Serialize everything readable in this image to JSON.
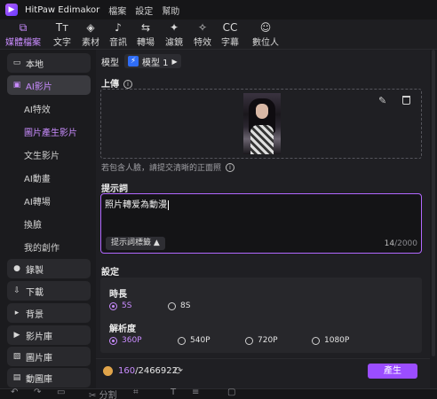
{
  "app": {
    "title": "HitPaw Edimakor",
    "logo_glyph": "▶",
    "menu": [
      "檔案",
      "設定",
      "幫助"
    ]
  },
  "toolbar": {
    "tools": [
      {
        "label": "媒體檔案",
        "icon": "media-files-icon",
        "glyph": "⧉",
        "active": true
      },
      {
        "label": "文字",
        "icon": "text-icon",
        "glyph": "Tт",
        "active": false
      },
      {
        "label": "素材",
        "icon": "assets-icon",
        "glyph": "◈",
        "active": false
      },
      {
        "label": "音訊",
        "icon": "audio-icon",
        "glyph": "♪",
        "active": false
      },
      {
        "label": "轉場",
        "icon": "transition-icon",
        "glyph": "⇆",
        "active": false
      },
      {
        "label": "濾鏡",
        "icon": "filter-icon",
        "glyph": "✦",
        "active": false
      },
      {
        "label": "特效",
        "icon": "effects-icon",
        "glyph": "✧",
        "active": false
      },
      {
        "label": "字幕",
        "icon": "subtitle-icon",
        "glyph": "CC",
        "active": false
      },
      {
        "label": "數位人",
        "icon": "digital-human-icon",
        "glyph": "☺",
        "active": false
      }
    ]
  },
  "sidebar": {
    "items": [
      {
        "label": "本地",
        "icon": "folder-icon",
        "glyph": "▭",
        "active": false
      },
      {
        "label": "AI影片",
        "icon": "ai-video-icon",
        "glyph": "▣",
        "active": true
      },
      {
        "label": "錄製",
        "icon": "record-icon",
        "glyph": "●",
        "active": false
      },
      {
        "label": "下載",
        "icon": "download-icon",
        "glyph": "⇩",
        "active": false
      },
      {
        "label": "背景",
        "icon": "background-icon",
        "glyph": "▸",
        "active": false
      },
      {
        "label": "影片庫",
        "icon": "video-library-icon",
        "glyph": "▶",
        "active": false
      },
      {
        "label": "圖片庫",
        "icon": "image-library-icon",
        "glyph": "▨",
        "active": false
      },
      {
        "label": "動圖庫",
        "icon": "gif-library-icon",
        "glyph": "▤",
        "active": false
      }
    ],
    "sub_items": [
      {
        "label": "AI特效",
        "active": false
      },
      {
        "label": "圖片產生影片",
        "active": true
      },
      {
        "label": "文生影片",
        "active": false
      },
      {
        "label": "AI動畫",
        "active": false
      },
      {
        "label": "AI轉場",
        "active": false
      },
      {
        "label": "換臉",
        "active": false
      },
      {
        "label": "我的創作",
        "active": false
      }
    ]
  },
  "main": {
    "model": {
      "label": "模型",
      "value": "模型 1",
      "bolt": "⚡",
      "caret": "▶"
    },
    "upload": {
      "title": "上傳",
      "info": "i",
      "hint": "若包含人臉，請提交清晰的正面照"
    },
    "prompt": {
      "title": "提示詞",
      "value": "照片轉爱為動漫",
      "tag_label": "提示詞標籤 ▲",
      "count": "14",
      "max": "/2000"
    },
    "settings": {
      "title": "設定",
      "duration": {
        "label": "時長",
        "options": [
          "5S",
          "8S"
        ],
        "selected": "5S"
      },
      "resolution": {
        "label": "解析度",
        "options": [
          "360P",
          "540P",
          "720P",
          "1080P"
        ],
        "selected": "360P"
      }
    }
  },
  "footer": {
    "credits_used": "160",
    "credits_total": "/2466922",
    "generate_label": "產生"
  },
  "editbar": {
    "split_label": "分割"
  },
  "colors": {
    "accent": "#c98cff",
    "button": "#9b4dff",
    "background": "#1f1f23"
  }
}
